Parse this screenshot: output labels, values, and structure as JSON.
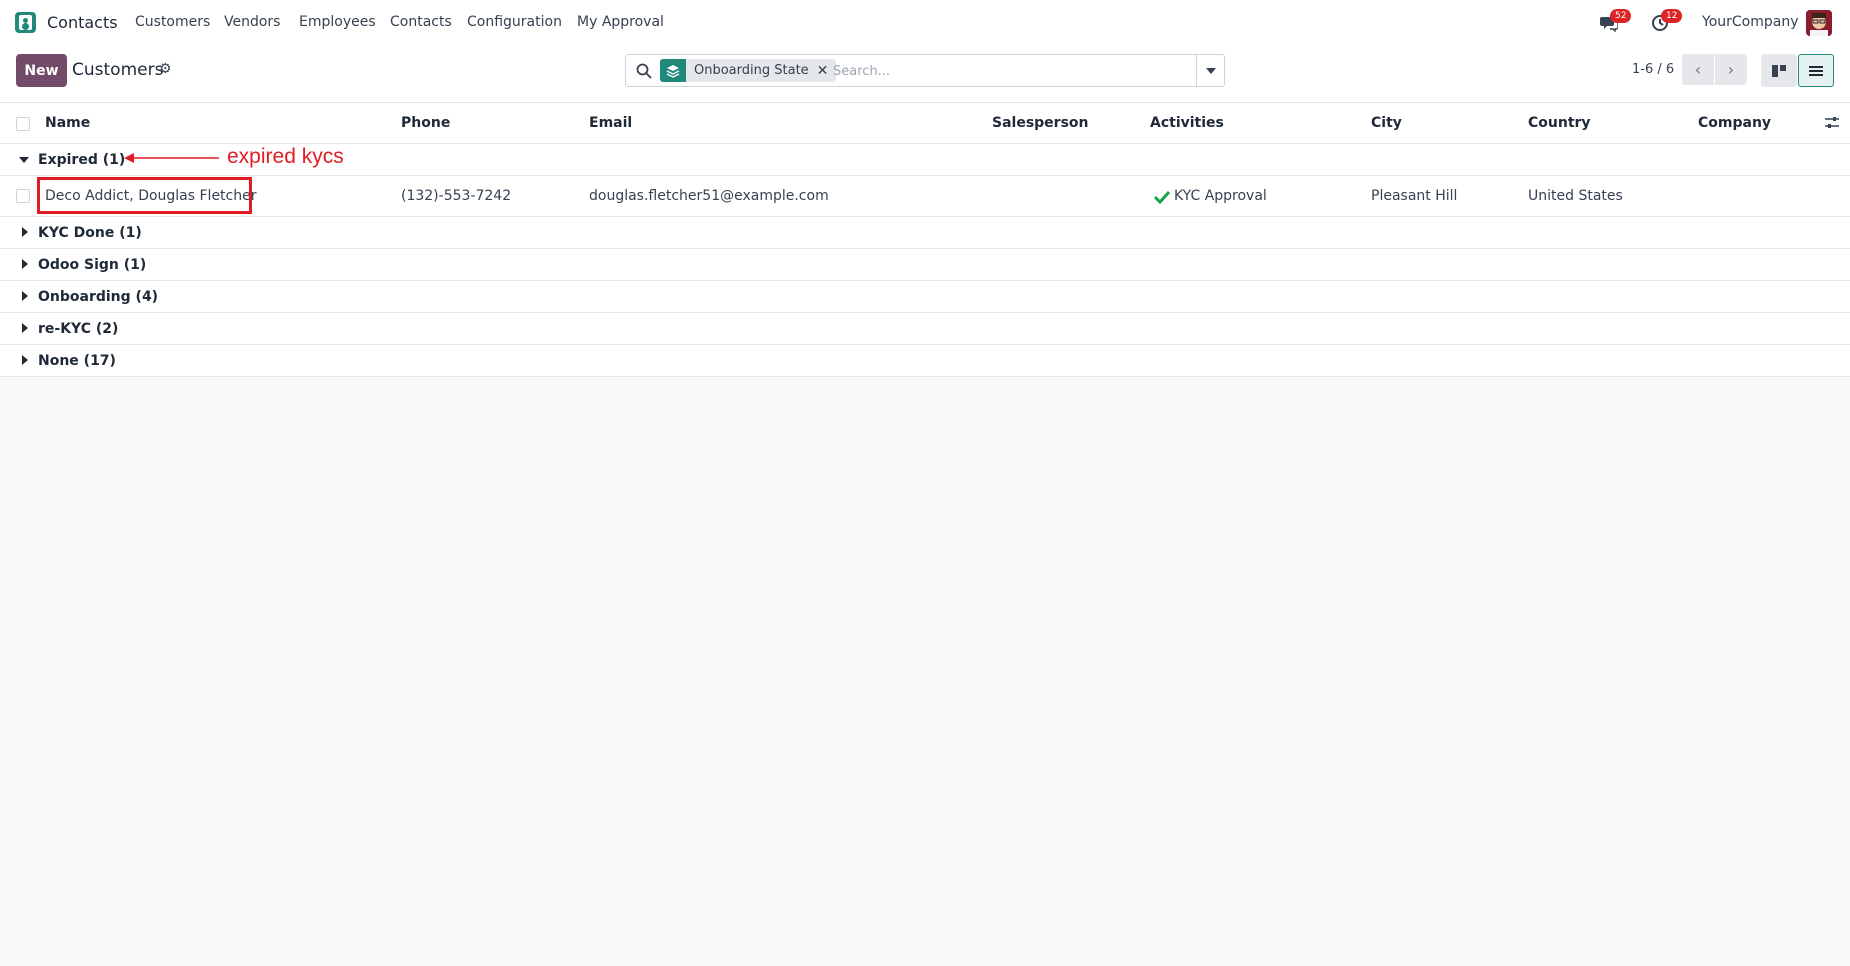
{
  "navbar": {
    "app_name": "Contacts",
    "menu": [
      "Customers",
      "Vendors",
      "Employees",
      "Contacts",
      "Configuration",
      "My Approval"
    ],
    "messages_badge": "52",
    "activities_badge": "12",
    "company": "YourCompany"
  },
  "control": {
    "new_label": "New",
    "title": "Customers",
    "facet_label": "Onboarding State",
    "search_placeholder": "Search...",
    "pager": "1-6 / 6"
  },
  "columns": [
    "Name",
    "Phone",
    "Email",
    "Salesperson",
    "Activities",
    "City",
    "Country",
    "Company"
  ],
  "groups": [
    {
      "label": "Expired (1)",
      "expanded": true
    },
    {
      "label": "KYC Done (1)",
      "expanded": false
    },
    {
      "label": "Odoo Sign (1)",
      "expanded": false
    },
    {
      "label": "Onboarding (4)",
      "expanded": false
    },
    {
      "label": "re-KYC (2)",
      "expanded": false
    },
    {
      "label": "None (17)",
      "expanded": false
    }
  ],
  "record": {
    "name": "Deco Addict, Douglas Fletcher",
    "phone": "(132)-553-7242",
    "email": "douglas.fletcher51@example.com",
    "salesperson": "",
    "activity": "KYC Approval",
    "city": "Pleasant Hill",
    "country": "United States",
    "company": ""
  },
  "annotation": {
    "text": "expired kycs",
    "color": "#e11d24"
  },
  "colors": {
    "brand": "#714b67",
    "teal": "#1f8a7a",
    "badge": "#dc2626",
    "success": "#16a34a"
  }
}
